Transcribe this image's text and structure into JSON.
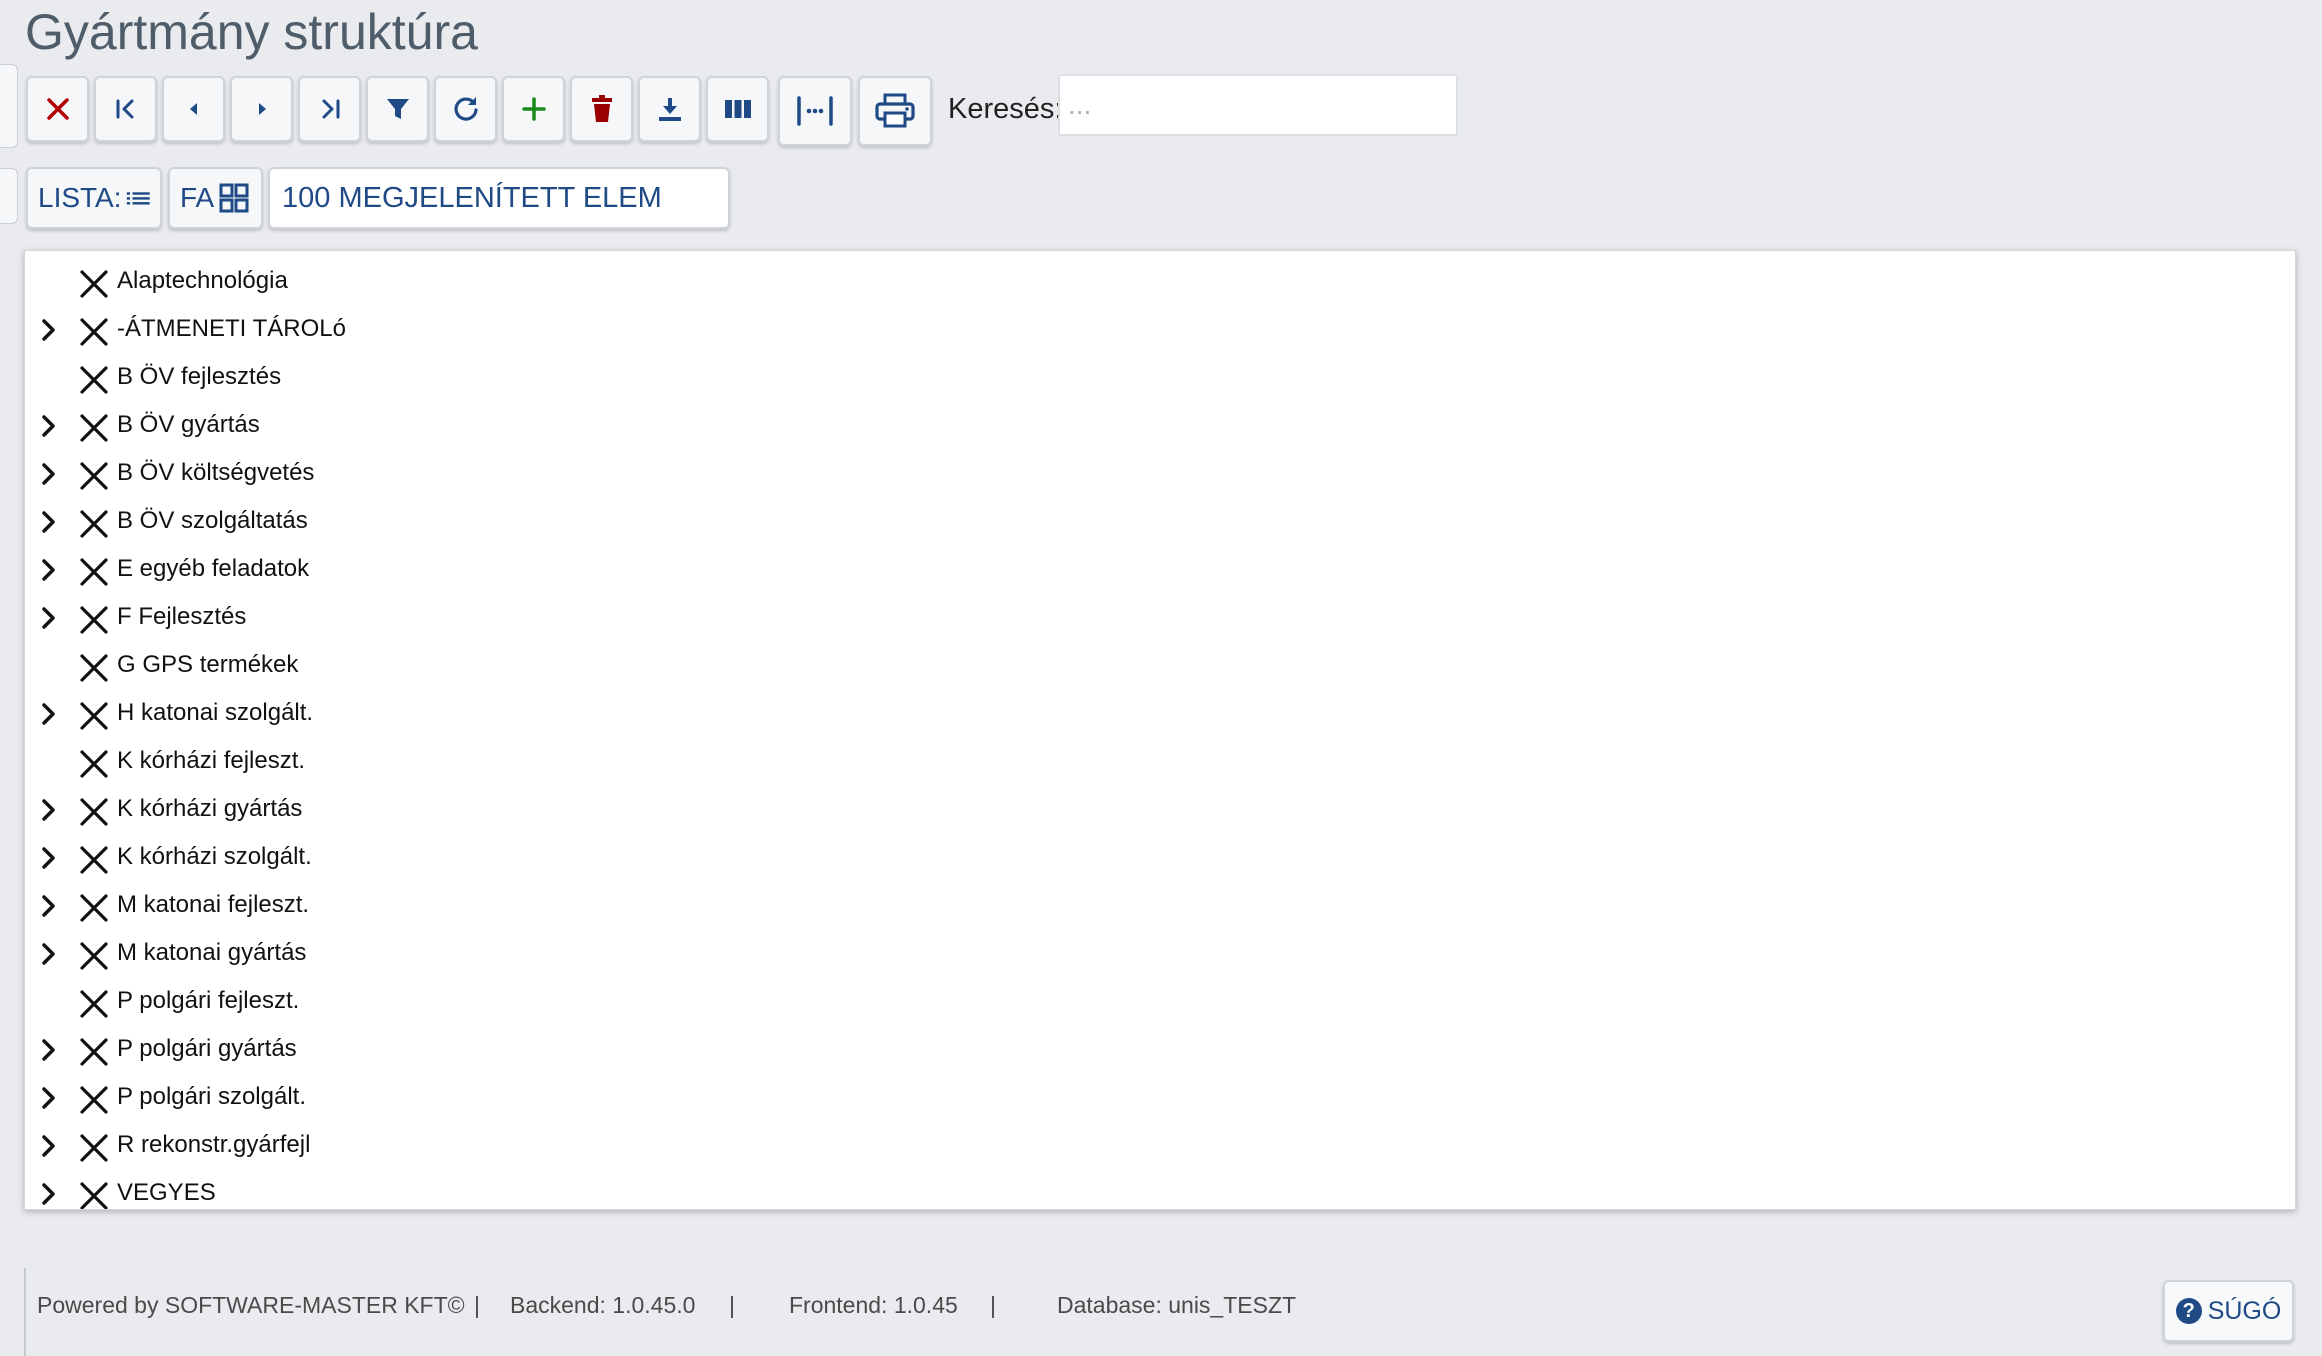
{
  "page": {
    "title": "Gyártmány struktúra"
  },
  "toolbar": {
    "buttons": [
      {
        "name": "close-button",
        "icon": "close-icon",
        "color": "#b30000"
      },
      {
        "name": "first-button",
        "icon": "first-page-icon",
        "color": "#1f4a86"
      },
      {
        "name": "prev-button",
        "icon": "caret-left-icon",
        "color": "#1f4a86"
      },
      {
        "name": "next-button",
        "icon": "caret-right-icon",
        "color": "#1f4a86"
      },
      {
        "name": "last-button",
        "icon": "last-page-icon",
        "color": "#1f4a86"
      },
      {
        "name": "filter-button",
        "icon": "filter-icon",
        "color": "#1f4a86"
      },
      {
        "name": "refresh-button",
        "icon": "refresh-icon",
        "color": "#1f4a86"
      },
      {
        "name": "add-button",
        "icon": "plus-icon",
        "color": "#1a8a1a"
      },
      {
        "name": "delete-button",
        "icon": "trash-icon",
        "color": "#9b0000"
      },
      {
        "name": "download-button",
        "icon": "download-icon",
        "color": "#1f4a86"
      },
      {
        "name": "columns-button",
        "icon": "columns-icon",
        "color": "#1f4a86"
      },
      {
        "name": "fit-width-button",
        "icon": "fit-width-icon",
        "color": "#1f4a86"
      },
      {
        "name": "print-button",
        "icon": "print-icon",
        "color": "#1f4a86"
      }
    ]
  },
  "search": {
    "label": "Keresés:",
    "placeholder": "...",
    "value": ""
  },
  "view": {
    "list_label": "LISTA:",
    "tree_label": "FA",
    "count_label": "100 MEGJELENÍTETT ELEM"
  },
  "tree": {
    "rows": [
      {
        "label": "Alaptechnológia",
        "expandable": false
      },
      {
        "label": "-ÁTMENETI TÁROLó",
        "expandable": true
      },
      {
        "label": "B ÖV fejlesztés",
        "expandable": false
      },
      {
        "label": "B ÖV gyártás",
        "expandable": true
      },
      {
        "label": "B ÖV költségvetés",
        "expandable": true
      },
      {
        "label": "B ÖV szolgáltatás",
        "expandable": true
      },
      {
        "label": "E egyéb feladatok",
        "expandable": true
      },
      {
        "label": "F Fejlesztés",
        "expandable": true
      },
      {
        "label": "G GPS termékek",
        "expandable": false
      },
      {
        "label": "H katonai szolgált.",
        "expandable": true
      },
      {
        "label": "K kórházi fejleszt.",
        "expandable": false
      },
      {
        "label": "K kórházi gyártás",
        "expandable": true
      },
      {
        "label": "K kórházi szolgált.",
        "expandable": true
      },
      {
        "label": "M katonai fejleszt.",
        "expandable": true
      },
      {
        "label": "M katonai gyártás",
        "expandable": true
      },
      {
        "label": "P polgári fejleszt.",
        "expandable": false
      },
      {
        "label": "P polgári gyártás",
        "expandable": true
      },
      {
        "label": "P polgári szolgált.",
        "expandable": true
      },
      {
        "label": "R rekonstr.gyárfejl",
        "expandable": true
      },
      {
        "label": "VEGYES",
        "expandable": true
      }
    ]
  },
  "footer": {
    "powered_by": "Powered by SOFTWARE-MASTER KFT©",
    "separator": "|",
    "backend": "Backend: 1.0.45.0",
    "frontend": "Frontend: 1.0.45",
    "database": "Database: unis_TESZT",
    "help_label": "SÚGÓ",
    "help_icon_glyph": "?"
  }
}
